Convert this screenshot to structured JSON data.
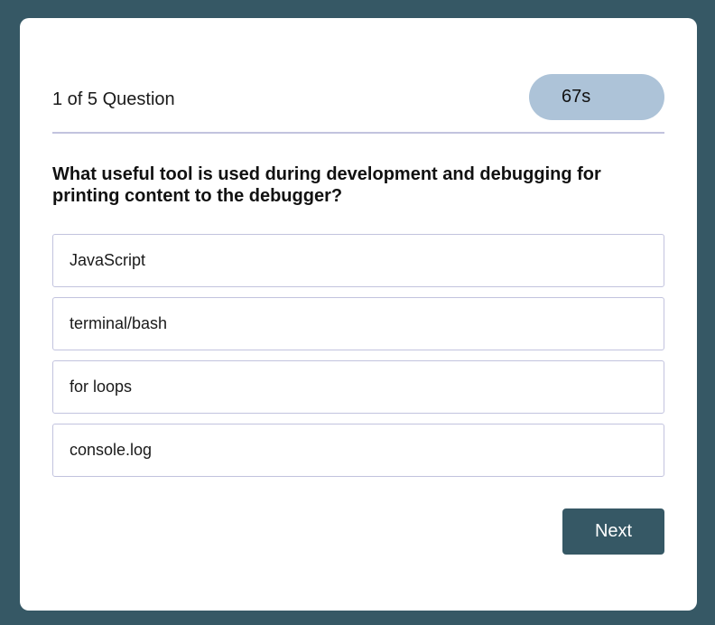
{
  "quiz": {
    "counter": "1 of 5 Question",
    "timer": "67s",
    "question": "What useful tool is used during development and debugging for printing content to the debugger?",
    "answers": [
      "JavaScript",
      "terminal/bash",
      "for loops",
      "console.log"
    ],
    "next_label": "Next"
  },
  "colors": {
    "background": "#365865",
    "card": "#ffffff",
    "timer_pill": "#adc3d8",
    "divider": "#c2c3de",
    "button": "#365865"
  }
}
